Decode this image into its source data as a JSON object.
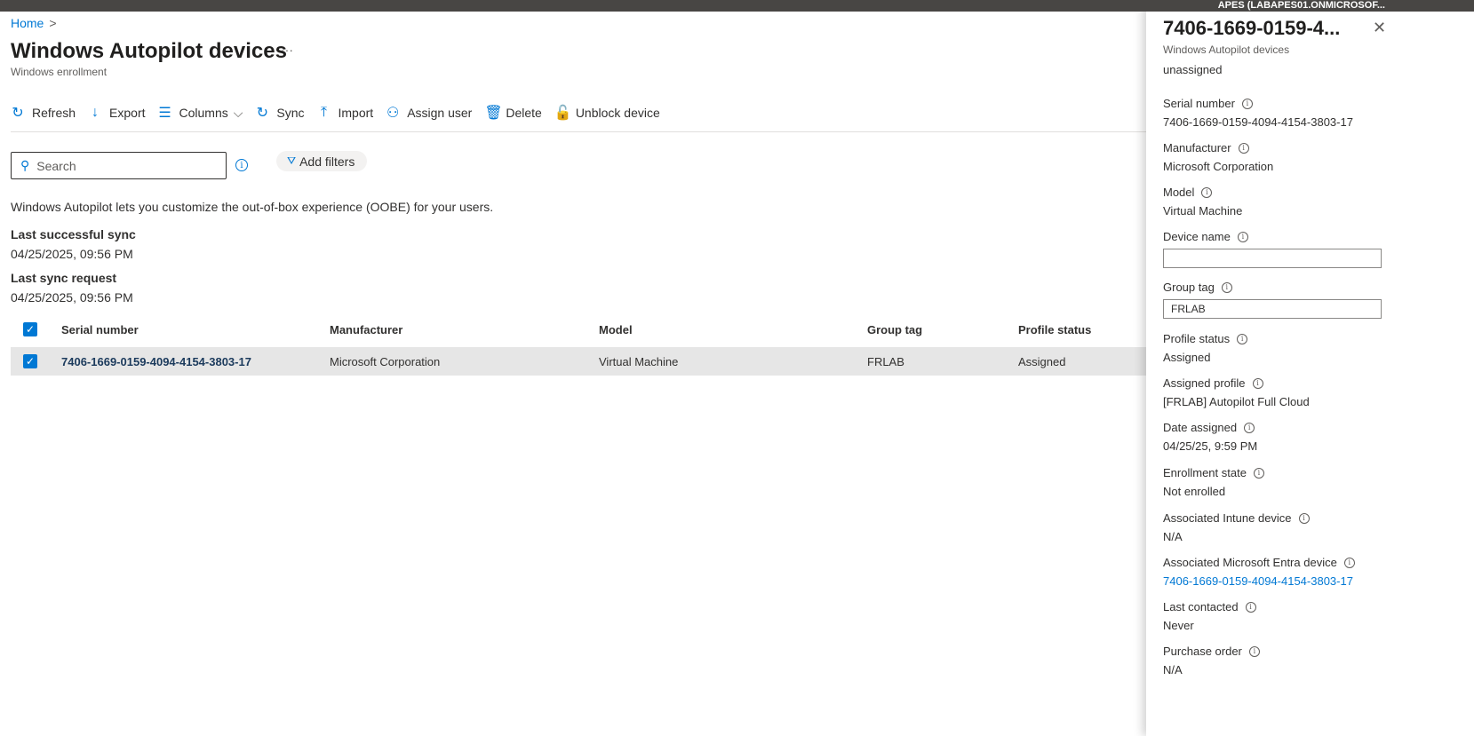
{
  "topbar": {
    "account": "APES (LABAPES01.ONMICROSOF..."
  },
  "breadcrumb": {
    "home": "Home",
    "sep": ">"
  },
  "page": {
    "title": "Windows Autopilot devices",
    "more": "···",
    "subtitle": "Windows enrollment"
  },
  "toolbar": [
    {
      "label": "Refresh",
      "icon": "↻"
    },
    {
      "label": "Export",
      "icon": "↓"
    },
    {
      "label": "Columns",
      "icon": "☰",
      "chevron": "⌵"
    },
    {
      "label": "Sync",
      "icon": "↻"
    },
    {
      "label": "Import",
      "icon": "⤒"
    },
    {
      "label": "Assign user",
      "icon": "⚇"
    },
    {
      "label": "Delete",
      "icon": "🗑"
    },
    {
      "label": "Unblock device",
      "icon": "🔓"
    }
  ],
  "search": {
    "placeholder": "Search"
  },
  "filters": {
    "label": "Add filters"
  },
  "description": "Windows Autopilot lets you customize the out-of-box experience (OOBE) for your users.",
  "sync": {
    "last_success_label": "Last successful sync",
    "last_success": "04/25/2025, 09:56 PM",
    "last_request_label": "Last sync request",
    "last_request": "04/25/2025, 09:56 PM"
  },
  "table": {
    "headers": [
      "Serial number",
      "Manufacturer",
      "Model",
      "Group tag",
      "Profile status"
    ],
    "rows": [
      [
        "7406-1669-0159-4094-4154-3803-17",
        "Microsoft Corporation",
        "Virtual Machine",
        "FRLAB",
        "Assigned"
      ]
    ]
  },
  "panel": {
    "title": "7406-1669-0159-4...",
    "subtitle": "Windows Autopilot devices",
    "top_value": "unassigned",
    "fields": [
      {
        "label": "Serial number",
        "value": "7406-1669-0159-4094-4154-3803-17"
      },
      {
        "label": "Manufacturer",
        "value": "Microsoft Corporation"
      },
      {
        "label": "Model",
        "value": "Virtual Machine"
      },
      {
        "label": "Device name",
        "value": ""
      },
      {
        "label": "Group tag",
        "value": "FRLAB"
      },
      {
        "label": "Profile status",
        "value": "Assigned"
      },
      {
        "label": "Assigned profile",
        "value": "[FRLAB] Autopilot Full Cloud"
      },
      {
        "label": "Date assigned",
        "value": "04/25/25, 9:59 PM"
      },
      {
        "label": "Enrollment state",
        "value": "Not enrolled"
      },
      {
        "label": "Associated Intune device",
        "value": "N/A"
      },
      {
        "label": "Associated Microsoft Entra device",
        "value": "7406-1669-0159-4094-4154-3803-17"
      },
      {
        "label": "Last contacted",
        "value": "Never"
      },
      {
        "label": "Purchase order",
        "value": "N/A"
      }
    ]
  },
  "colors": {
    "accent": "#0078d4",
    "row_selected": "#e6e6e6"
  }
}
